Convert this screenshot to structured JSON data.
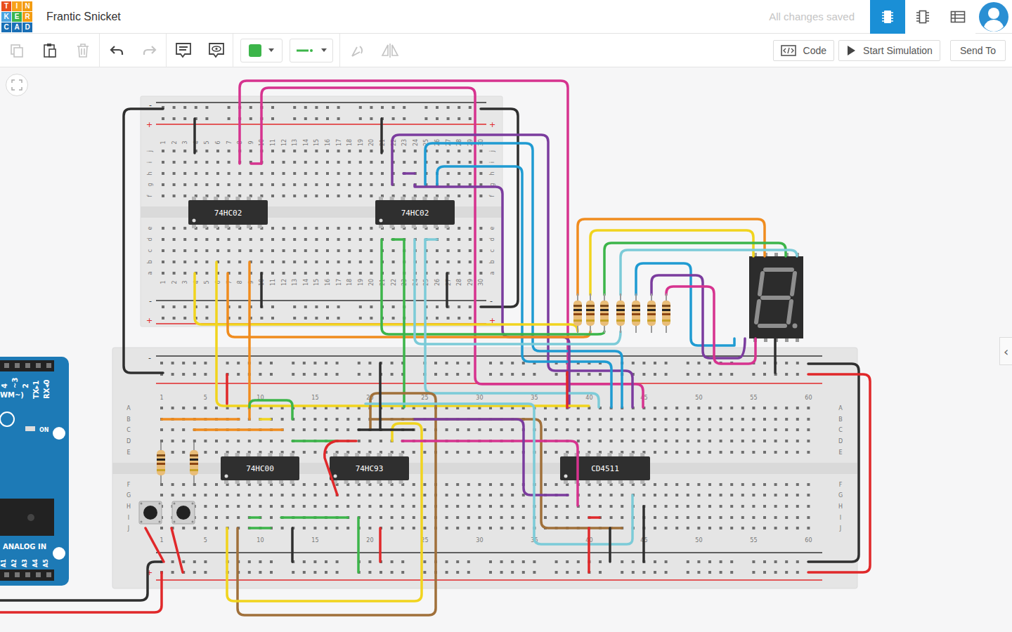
{
  "app": {
    "logo": [
      "T",
      "I",
      "N",
      "K",
      "E",
      "R",
      "C",
      "A",
      "D"
    ],
    "title": "Frantic Snicket",
    "save_status": "All changes saved"
  },
  "view_tabs": [
    {
      "selected": true
    },
    {
      "selected": false
    },
    {
      "selected": false
    }
  ],
  "toolbar": {
    "tools": [
      {
        "disabled": true
      },
      {
        "disabled": false
      },
      {
        "disabled": true
      },
      {
        "disabled": false
      },
      {
        "disabled": true
      },
      {
        "disabled": false
      },
      {
        "disabled": false
      },
      {
        "disabled": true
      },
      {
        "disabled": true
      }
    ],
    "wire_color": "#3cb54a",
    "buttons": [
      "Code",
      "Start Simulation",
      "Send To"
    ]
  },
  "canvas": {
    "panel_toggle": "‹"
  },
  "top_board": {
    "columns": [
      "1",
      "2",
      "3",
      "4",
      "5",
      "6",
      "7",
      "8",
      "9",
      "10",
      "11",
      "12",
      "13",
      "14",
      "15",
      "16",
      "17",
      "18",
      "19",
      "20",
      "21",
      "22",
      "23",
      "24",
      "25",
      "26",
      "27",
      "28",
      "29",
      "30"
    ],
    "rows_upper": [
      "j",
      "i",
      "h",
      "g",
      "f"
    ],
    "rows_lower": [
      "e",
      "d",
      "c",
      "b",
      "a"
    ],
    "rails": [
      "-",
      "+"
    ]
  },
  "main_board": {
    "columns": [
      "1",
      "5",
      "10",
      "15",
      "20",
      "25",
      "30",
      "35",
      "40",
      "45",
      "50",
      "55",
      "60"
    ],
    "rows_upper": [
      "A",
      "B",
      "C",
      "D",
      "E"
    ],
    "rows_lower": [
      "F",
      "G",
      "H",
      "I",
      "J"
    ],
    "rails": [
      "-",
      "+"
    ]
  },
  "chips": [
    {
      "label": "74HC02"
    },
    {
      "label": "74HC02"
    },
    {
      "label": "74HC00"
    },
    {
      "label": "74HC93"
    },
    {
      "label": "CD4511"
    }
  ],
  "arduino": {
    "pins": [
      "4",
      "~3",
      "2",
      "TX▸1",
      "RX◂0"
    ],
    "pwm": "WM~)",
    "switch": "ON",
    "analog": "ANALOG IN",
    "analog_pins": [
      "A1",
      "A2",
      "A3",
      "A4",
      "A5"
    ]
  },
  "wires": [
    {
      "color": "#2f2f2f"
    },
    {
      "color": "#2f2f2f"
    },
    {
      "color": "#d6338f"
    },
    {
      "color": "#d6338f"
    },
    {
      "color": "#7b3c9e"
    },
    {
      "color": "#1f9bd2"
    },
    {
      "color": "#1f9bd2"
    },
    {
      "color": "#7b3c9e"
    },
    {
      "color": "#d6338f"
    },
    {
      "color": "#7b3c9e"
    },
    {
      "color": "#f1d41e"
    },
    {
      "color": "#f1d41e"
    },
    {
      "color": "#f08c1e"
    },
    {
      "color": "#f08c1e"
    },
    {
      "color": "#3cb54a"
    },
    {
      "color": "#3cb54a"
    },
    {
      "color": "#7ccbd8"
    },
    {
      "color": "#7ccbd8"
    },
    {
      "color": "#7ccbd8"
    },
    {
      "color": "#f08c1e"
    },
    {
      "color": "#f1d41e"
    },
    {
      "color": "#3cb54a"
    },
    {
      "color": "#7ccbd8"
    },
    {
      "color": "#1f9bd2"
    },
    {
      "color": "#7b3c9e"
    },
    {
      "color": "#d6338f"
    },
    {
      "color": "#2f2f2f"
    },
    {
      "color": "#2f2f2f"
    },
    {
      "color": "#e0282a"
    },
    {
      "color": "#2f2f2f"
    },
    {
      "color": "#e0282a"
    },
    {
      "color": "#e0282a"
    },
    {
      "color": "#e0282a"
    },
    {
      "color": "#f08c1e"
    },
    {
      "color": "#f08c1e"
    },
    {
      "color": "#f1d41e"
    },
    {
      "color": "#3cb54a"
    },
    {
      "color": "#3cb54a"
    },
    {
      "color": "#e0282a"
    },
    {
      "color": "#a0703a"
    },
    {
      "color": "#f1d41e"
    },
    {
      "color": "#a0703a"
    },
    {
      "color": "#2f2f2f"
    },
    {
      "color": "#d6338f"
    },
    {
      "color": "#7b3c9e"
    },
    {
      "color": "#7ccbd8"
    },
    {
      "color": "#3cb54a"
    },
    {
      "color": "#e0282a"
    },
    {
      "color": "#2f2f2f"
    },
    {
      "color": "#3cb54a"
    },
    {
      "color": "#3cb54a"
    },
    {
      "color": "#3cb54a"
    },
    {
      "color": "#2f2f2f"
    },
    {
      "color": "#e0282a"
    },
    {
      "color": "#e0282a"
    },
    {
      "color": "#2f2f2f"
    },
    {
      "color": "#2f2f2f"
    },
    {
      "color": "#e0282a"
    },
    {
      "color": "#2f2f2f"
    },
    {
      "color": "#2f2f2f"
    },
    {
      "color": "#2f2f2f"
    },
    {
      "color": "#2f2f2f"
    },
    {
      "color": "#e0282a"
    }
  ]
}
